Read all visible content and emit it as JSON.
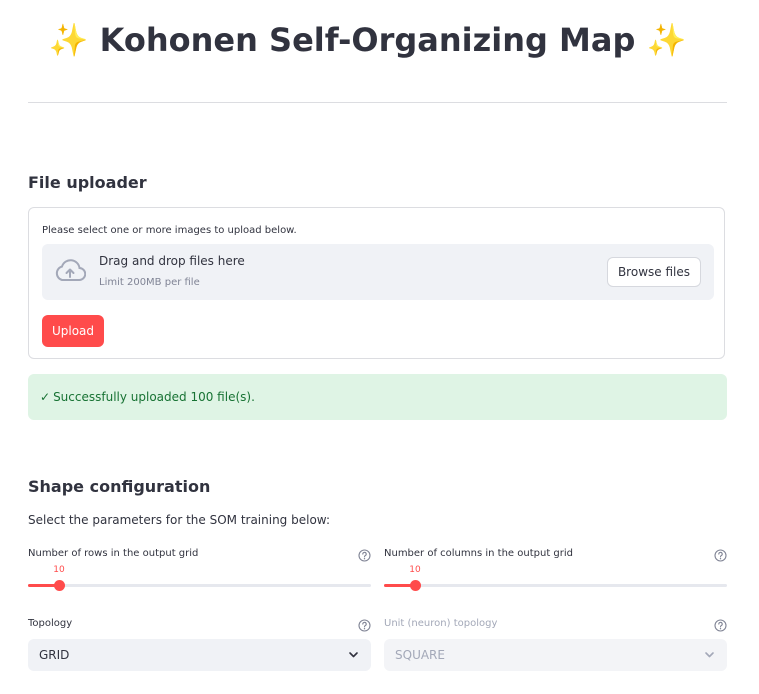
{
  "header": {
    "title": "Kohonen Self-Organizing Map",
    "sparkle_left": "✨",
    "sparkle_right": "✨"
  },
  "file_uploader": {
    "heading": "File uploader",
    "prompt": "Please select one or more images to upload below.",
    "dropzone_text": "Drag and drop files here",
    "limit_text": "Limit 200MB per file",
    "browse_label": "Browse files",
    "upload_label": "Upload"
  },
  "status": {
    "check": "✓",
    "message": "Successfully uploaded 100 file(s)."
  },
  "shape_config": {
    "heading": "Shape configuration",
    "intro": "Select the parameters for the SOM training below:",
    "rows_slider": {
      "label": "Number of rows in the output grid",
      "value": "10",
      "fill_fraction": 0.09
    },
    "cols_slider": {
      "label": "Number of columns in the output grid",
      "value": "10",
      "fill_fraction": 0.09
    },
    "topology": {
      "label": "Topology",
      "value": "GRID"
    },
    "unit_topology": {
      "label": "Unit (neuron) topology",
      "value": "SQUARE",
      "disabled": true
    }
  },
  "colors": {
    "accent": "#ff4b4b",
    "success_bg": "#dff4e5",
    "success_text": "#177233"
  }
}
